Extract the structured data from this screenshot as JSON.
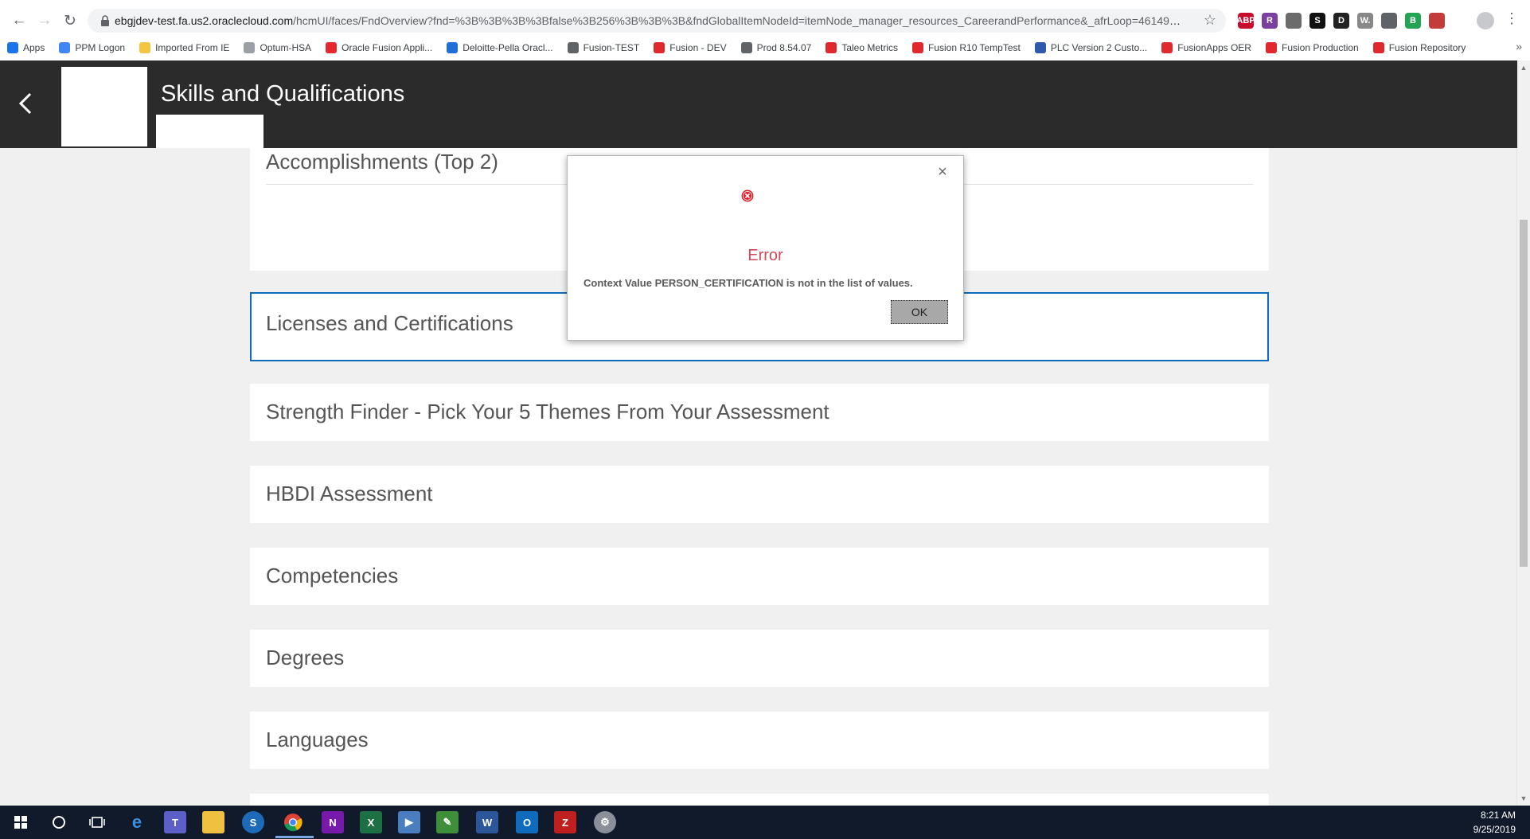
{
  "browser": {
    "url_host": "ebgjdev-test.fa.us2.oraclecloud.com",
    "url_path": "/hcmUI/faces/FndOverview?fnd=%3B%3B%3B%3Bfalse%3B256%3B%3B%3B&fndGlobalItemNodeId=itemNode_manager_resources_CareerandPerformance&_afrLoop=461498124660..."
  },
  "bookmarks": [
    {
      "label": "Apps",
      "icon": "apps-grid-icon",
      "color": "#1a73e8"
    },
    {
      "label": "PPM Logon",
      "icon": "google-g-icon",
      "color": "#4285f4"
    },
    {
      "label": "Imported From IE",
      "icon": "folder-icon",
      "color": "#f4c542"
    },
    {
      "label": "Optum-HSA",
      "icon": "cloud-icon",
      "color": "#9aa0a6"
    },
    {
      "label": "Oracle Fusion Appli...",
      "icon": "oracle-icon",
      "color": "#e0282d"
    },
    {
      "label": "Deloitte-Pella Oracl...",
      "icon": "sharepoint-icon",
      "color": "#1e6fd9"
    },
    {
      "label": "Fusion-TEST",
      "icon": "globe-icon",
      "color": "#5f6368"
    },
    {
      "label": "Fusion - DEV",
      "icon": "oracle-icon",
      "color": "#e0282d"
    },
    {
      "label": "Prod 8.54.07",
      "icon": "globe-icon",
      "color": "#5f6368"
    },
    {
      "label": "Taleo Metrics",
      "icon": "taleo-icon",
      "color": "#e0282d"
    },
    {
      "label": "Fusion R10 TempTest",
      "icon": "oracle-icon",
      "color": "#e0282d"
    },
    {
      "label": "PLC Version 2 Custo...",
      "icon": "globe-icon",
      "color": "#2e5aac"
    },
    {
      "label": "FusionApps OER",
      "icon": "oracle-ring-icon",
      "color": "#e0282d"
    },
    {
      "label": "Fusion Production",
      "icon": "oracle-icon",
      "color": "#e0282d"
    },
    {
      "label": "Fusion Repository",
      "icon": "oracle-ring-icon",
      "color": "#e0282d"
    }
  ],
  "extensions": [
    {
      "name": "abp-icon",
      "label": "ABP",
      "color": "#c70d2c"
    },
    {
      "name": "r-extension-icon",
      "label": "R",
      "color": "#7b3fa0"
    },
    {
      "name": "satellite-icon",
      "label": "",
      "color": "#6b6b6b"
    },
    {
      "name": "s-extension-icon",
      "label": "S",
      "color": "#111111"
    },
    {
      "name": "d-extension-icon",
      "label": "D",
      "color": "#222222"
    },
    {
      "name": "w-extension-icon",
      "label": "W.",
      "color": "#888888"
    },
    {
      "name": "circle-extension-icon",
      "label": "",
      "color": "#5f6368"
    },
    {
      "name": "b-extension-icon",
      "label": "B",
      "color": "#23a455"
    },
    {
      "name": "pdf-icon",
      "label": "",
      "color": "#c43b3b"
    }
  ],
  "header": {
    "title": "Skills and Qualifications"
  },
  "sections": {
    "accomplishments": "Accomplishments (Top 2)",
    "licenses": "Licenses and Certifications",
    "strength": "Strength Finder - Pick Your 5 Themes From Your Assessment",
    "hbdi": "HBDI Assessment",
    "competencies": "Competencies",
    "degrees": "Degrees",
    "languages": "Languages"
  },
  "dialog": {
    "title": "Error",
    "message": "Context Value PERSON_CERTIFICATION is not in the list of values.",
    "ok_label": "OK",
    "close_symbol": "×"
  },
  "taskbar": {
    "time": "8:21 AM",
    "date": "9/25/2019"
  },
  "colors": {
    "header_bg": "#2b2b2b",
    "error_red": "#d3475b",
    "focus_blue": "#0f6cbd"
  }
}
